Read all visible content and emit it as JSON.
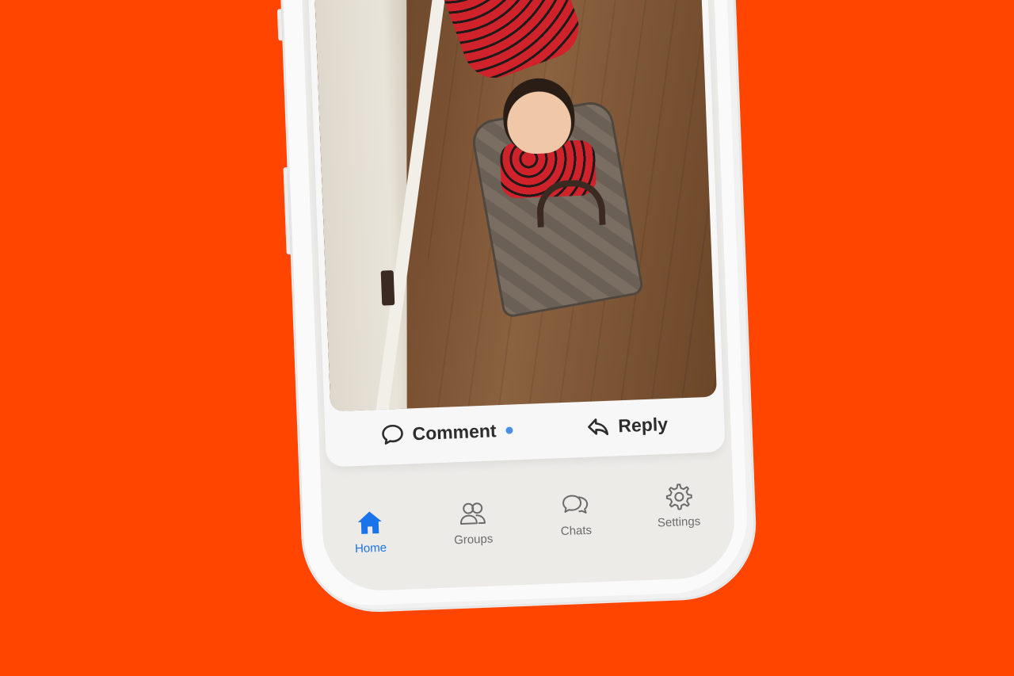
{
  "post": {
    "photo_description_icon": "photo",
    "comment_label": "Comment",
    "reply_label": "Reply",
    "comment_icon": "speech-bubble-icon",
    "reply_icon": "reply-arrow-icon"
  },
  "tabbar": {
    "items": [
      {
        "label": "Home",
        "icon": "house-icon",
        "active": true
      },
      {
        "label": "Groups",
        "icon": "people-icon",
        "active": false
      },
      {
        "label": "Chats",
        "icon": "chat-bubbles-icon",
        "active": false
      },
      {
        "label": "Settings",
        "icon": "gear-icon",
        "active": false
      }
    ]
  },
  "colors": {
    "background": "#FF4500",
    "accent": "#1A73E8",
    "unread_dot": "#4A8FE7",
    "inactive": "#6B6B6B"
  }
}
